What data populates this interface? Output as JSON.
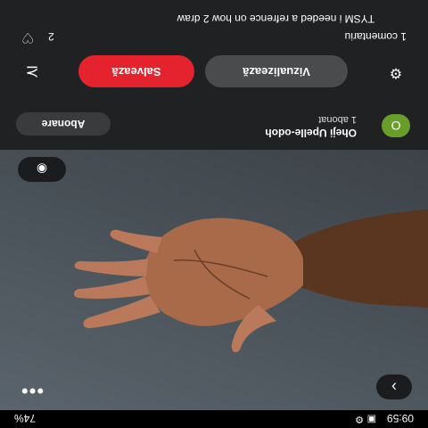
{
  "status": {
    "time": "09:59",
    "battery": "74%"
  },
  "creator": {
    "avatar_letter": "O",
    "name": "Oheji Upelle-odoh",
    "subscribers": "1 abonat",
    "subscribe_label": "Abonare"
  },
  "actions": {
    "view_label": "Vizualizează",
    "save_label": "Salvează"
  },
  "comments": {
    "count_label": "1 comentariu",
    "likes": "2",
    "text": "TYSM i needed a refrence on how 2 draw"
  },
  "colors": {
    "save_button": "#e5232f",
    "avatar": "#6a9e2a"
  },
  "icons": [
    "chevron-right-icon",
    "more-dots-icon",
    "lens-icon",
    "gear-icon",
    "share-icon",
    "heart-icon"
  ]
}
